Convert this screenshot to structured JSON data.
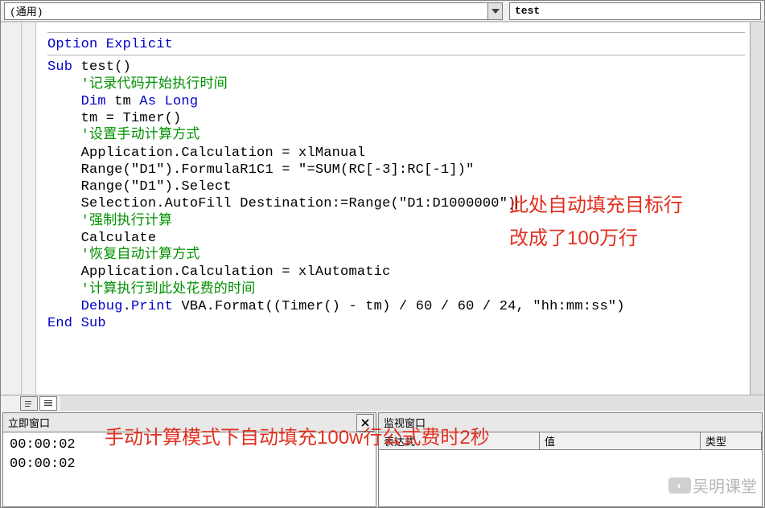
{
  "dropdowns": {
    "object_label": "(通用)",
    "procedure_label": "test"
  },
  "code": {
    "l0": "Option Explicit",
    "l1a": "Sub",
    "l1b": " test()",
    "l2": "    '记录代码开始执行时间",
    "l3a": "    Dim",
    "l3b": " tm ",
    "l3c": "As Long",
    "l4": "    tm = Timer()",
    "l5": "    '设置手动计算方式",
    "l6": "    Application.Calculation = xlManual",
    "l7": "    Range(\"D1\").FormulaR1C1 = \"=SUM(RC[-3]:RC[-1])\"",
    "l8": "    Range(\"D1\").Select",
    "l9": "    Selection.AutoFill Destination:=Range(\"D1:D1000000\")",
    "l10": "    '强制执行计算",
    "l11": "    Calculate",
    "l12": "    '恢复自动计算方式",
    "l13": "    Application.Calculation = xlAutomatic",
    "l14": "    '计算执行到此处花费的时间",
    "l15a": "    Debug",
    "l15b": ".",
    "l15c": "Print",
    "l15d": " VBA.Format((Timer() - tm) / 60 / 60 / 24, \"hh:mm:ss\")",
    "l16": "End Sub"
  },
  "annotations": {
    "right1": "此处自动填充目标行",
    "right2": "改成了100万行",
    "bottom": "手动计算模式下自动填充100w行公式费时2秒"
  },
  "immediate": {
    "title": "立即窗口",
    "lines": [
      " 00:00:02",
      " 00:00:02"
    ]
  },
  "watch": {
    "title": "监视窗口",
    "columns": [
      "表达式",
      "值",
      "类型"
    ]
  },
  "watermark": "吴明课堂"
}
